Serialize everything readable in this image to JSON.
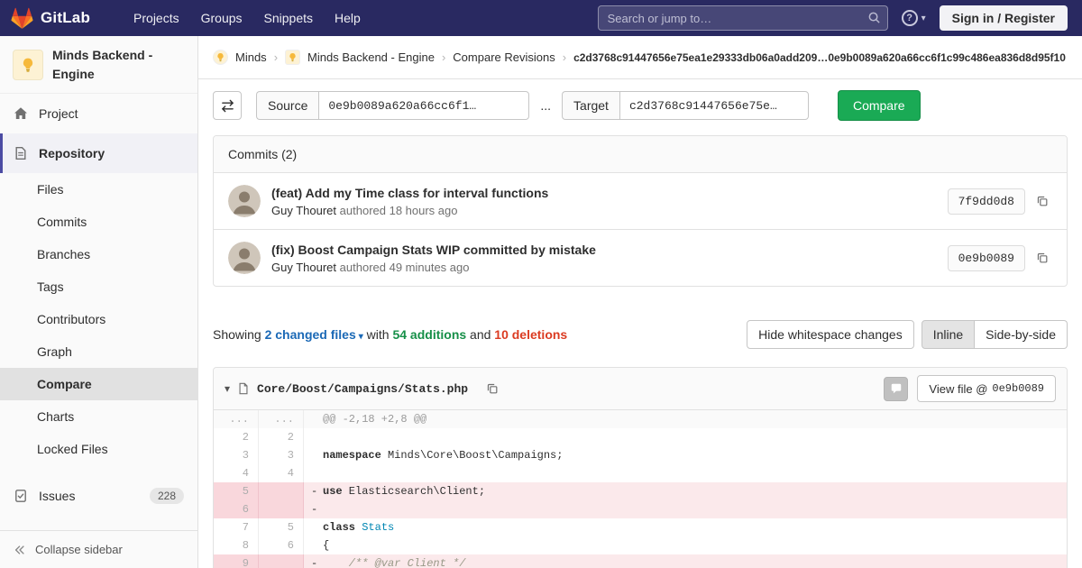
{
  "icons": {
    "help_glyph": "?",
    "chevron_down": "▾",
    "caret_down": "▾",
    "breadcrumb_separator": "›"
  },
  "navbar": {
    "brand": "GitLab",
    "menu": [
      "Projects",
      "Groups",
      "Snippets",
      "Help"
    ],
    "search_placeholder": "Search or jump to…",
    "sign_in_label": "Sign in / Register"
  },
  "sidebar": {
    "project_title": "Minds Backend - Engine",
    "items": [
      {
        "label": "Project",
        "icon": "home",
        "type": "top"
      },
      {
        "label": "Repository",
        "icon": "repo",
        "type": "top",
        "active": true
      },
      {
        "label": "Files",
        "type": "sub"
      },
      {
        "label": "Commits",
        "type": "sub"
      },
      {
        "label": "Branches",
        "type": "sub"
      },
      {
        "label": "Tags",
        "type": "sub"
      },
      {
        "label": "Contributors",
        "type": "sub"
      },
      {
        "label": "Graph",
        "type": "sub"
      },
      {
        "label": "Compare",
        "type": "sub",
        "active": true
      },
      {
        "label": "Charts",
        "type": "sub"
      },
      {
        "label": "Locked Files",
        "type": "sub"
      },
      {
        "label": "Issues",
        "icon": "issues",
        "type": "top",
        "badge": "228",
        "gap": true
      }
    ],
    "collapse_label": "Collapse sidebar"
  },
  "breadcrumb": {
    "items": [
      {
        "label": "Minds",
        "avatar": true,
        "round": true
      },
      {
        "label": "Minds Backend - Engine",
        "avatar": true
      },
      {
        "label": "Compare Revisions"
      }
    ],
    "current": "c2d3768c91447656e75ea1e29333db06a0add209…0e9b0089a620a66cc6f1c99c486ea836d8d95f10"
  },
  "compare_form": {
    "source_label": "Source",
    "source_value": "0e9b0089a620a66cc6f1…",
    "separator": "...",
    "target_label": "Target",
    "target_value": "c2d3768c91447656e75e…",
    "compare_label": "Compare"
  },
  "commits": {
    "header": "Commits (2)",
    "items": [
      {
        "title": "(feat) Add my Time class for interval functions",
        "author": "Guy Thouret",
        "meta": "authored 18 hours ago",
        "sha": "7f9dd0d8"
      },
      {
        "title": "(fix) Boost Campaign Stats WIP committed by mistake",
        "author": "Guy Thouret",
        "meta": "authored 49 minutes ago",
        "sha": "0e9b0089"
      }
    ]
  },
  "diff_stats": {
    "showing": "Showing",
    "files_link": "2 changed files",
    "with": "with",
    "additions": "54 additions",
    "and": "and",
    "deletions": "10 deletions",
    "hide_whitespace_label": "Hide whitespace changes",
    "inline_label": "Inline",
    "side_by_side_label": "Side-by-side"
  },
  "diff_file": {
    "filename": "Core/Boost/Campaigns/Stats.php",
    "view_file_label": "View file @",
    "view_file_sha": "0e9b0089",
    "lines": [
      {
        "type": "hunk",
        "old": "...",
        "new": "...",
        "mark": "",
        "tokens": [
          {
            "c": "",
            "t": "@@ -2,18 +2,8 @@"
          }
        ]
      },
      {
        "type": "ctx",
        "old": "2",
        "new": "2",
        "mark": "",
        "tokens": []
      },
      {
        "type": "ctx",
        "old": "3",
        "new": "3",
        "mark": "",
        "tokens": [
          {
            "c": "k",
            "t": "namespace"
          },
          {
            "c": "",
            "t": " Minds\\Core\\Boost\\Campaigns;"
          }
        ]
      },
      {
        "type": "ctx",
        "old": "4",
        "new": "4",
        "mark": "",
        "tokens": []
      },
      {
        "type": "del",
        "old": "5",
        "new": "",
        "mark": "-",
        "tokens": [
          {
            "c": "k",
            "t": "use"
          },
          {
            "c": "",
            "t": " Elasticsearch\\Client;"
          }
        ]
      },
      {
        "type": "del",
        "old": "6",
        "new": "",
        "mark": "-",
        "tokens": []
      },
      {
        "type": "ctx",
        "old": "7",
        "new": "5",
        "mark": "",
        "tokens": [
          {
            "c": "k",
            "t": "class"
          },
          {
            "c": "",
            "t": " "
          },
          {
            "c": "nc",
            "t": "Stats"
          }
        ]
      },
      {
        "type": "ctx",
        "old": "8",
        "new": "6",
        "mark": "",
        "tokens": [
          {
            "c": "",
            "t": "{"
          }
        ]
      },
      {
        "type": "del",
        "old": "9",
        "new": "",
        "mark": "-",
        "tokens": [
          {
            "c": "c",
            "t": "    /** @var Client */"
          }
        ]
      }
    ]
  }
}
